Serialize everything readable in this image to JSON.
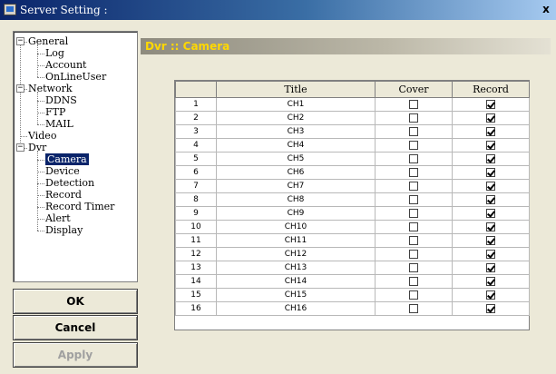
{
  "window": {
    "title": "Server Setting :",
    "close_label": "x"
  },
  "tree": {
    "items": [
      {
        "label": "General",
        "expander": "−"
      },
      {
        "label": "Log"
      },
      {
        "label": "Account"
      },
      {
        "label": "OnLineUser"
      },
      {
        "label": "Network",
        "expander": "−"
      },
      {
        "label": "DDNS"
      },
      {
        "label": "FTP"
      },
      {
        "label": "MAIL"
      },
      {
        "label": "Video"
      },
      {
        "label": "Dvr",
        "expander": "−"
      },
      {
        "label": "Camera",
        "selected": true
      },
      {
        "label": "Device"
      },
      {
        "label": "Detection"
      },
      {
        "label": "Record"
      },
      {
        "label": "Record Timer"
      },
      {
        "label": "Alert"
      },
      {
        "label": "Display"
      }
    ]
  },
  "buttons": {
    "ok": "OK",
    "cancel": "Cancel",
    "apply": "Apply"
  },
  "heading": "Dvr :: Camera",
  "table": {
    "columns": [
      "",
      "Title",
      "Cover",
      "Record"
    ],
    "rows": [
      {
        "num": "1",
        "title": "CH1",
        "cover": false,
        "record": true
      },
      {
        "num": "2",
        "title": "CH2",
        "cover": false,
        "record": true
      },
      {
        "num": "3",
        "title": "CH3",
        "cover": false,
        "record": true
      },
      {
        "num": "4",
        "title": "CH4",
        "cover": false,
        "record": true
      },
      {
        "num": "5",
        "title": "CH5",
        "cover": false,
        "record": true
      },
      {
        "num": "6",
        "title": "CH6",
        "cover": false,
        "record": true
      },
      {
        "num": "7",
        "title": "CH7",
        "cover": false,
        "record": true
      },
      {
        "num": "8",
        "title": "CH8",
        "cover": false,
        "record": true
      },
      {
        "num": "9",
        "title": "CH9",
        "cover": false,
        "record": true
      },
      {
        "num": "10",
        "title": "CH10",
        "cover": false,
        "record": true
      },
      {
        "num": "11",
        "title": "CH11",
        "cover": false,
        "record": true
      },
      {
        "num": "12",
        "title": "CH12",
        "cover": false,
        "record": true
      },
      {
        "num": "13",
        "title": "CH13",
        "cover": false,
        "record": true
      },
      {
        "num": "14",
        "title": "CH14",
        "cover": false,
        "record": true
      },
      {
        "num": "15",
        "title": "CH15",
        "cover": false,
        "record": true
      },
      {
        "num": "16",
        "title": "CH16",
        "cover": false,
        "record": true
      }
    ]
  }
}
